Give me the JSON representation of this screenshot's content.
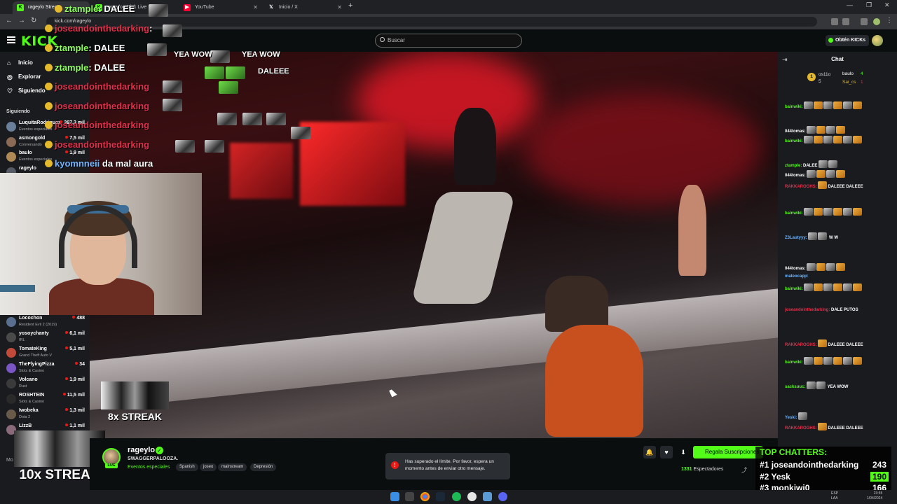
{
  "browser": {
    "tabs": [
      {
        "label": "rageylo Stream",
        "icon": "kick-icon"
      },
      {
        "label": "rageylo - Kick Live",
        "icon": "kick-icon"
      },
      {
        "label": "rageylo",
        "icon": "kick-icon"
      },
      {
        "label": "YouTube",
        "icon": "youtube-icon"
      },
      {
        "label": "Inicio / X",
        "icon": "x-icon"
      }
    ],
    "url": "kick.com/rageylo"
  },
  "header": {
    "logo": "KICK",
    "search_placeholder": "Buscar",
    "kicks_button": "Obtén KICKs"
  },
  "sidebar": {
    "nav": [
      {
        "label": "Inicio",
        "icon": "home-icon"
      },
      {
        "label": "Explorar",
        "icon": "compass-icon"
      },
      {
        "label": "Siguiendo",
        "icon": "heart-icon"
      }
    ],
    "following_title": "Siguiendo",
    "following": [
      {
        "name": "LuquitaRodriguez",
        "category": "Eventos especiales",
        "viewers": "397,3 mil",
        "color": "#6a7f99"
      },
      {
        "name": "asmongold",
        "category": "Conversando",
        "viewers": "7,5 mil",
        "color": "#8a6a55"
      },
      {
        "name": "baulo",
        "category": "Eventos especiales",
        "viewers": "1,9 mil",
        "color": "#b08a55"
      },
      {
        "name": "rageylo",
        "category": "",
        "viewers": "",
        "color": "#555a66"
      }
    ],
    "more": [
      {
        "name": "Locochon",
        "category": "Resident Evil 2 (2019)",
        "viewers": "488",
        "color": "#5a6f8f"
      },
      {
        "name": "yosoychanty",
        "category": "IRL",
        "viewers": "6,1 mil",
        "color": "#4a4a4a"
      },
      {
        "name": "TomateKing",
        "category": "Grand Theft Auto V",
        "viewers": "5,1 mil",
        "color": "#c24a3a"
      },
      {
        "name": "TheFlyingPizza",
        "category": "Slots & Casino",
        "viewers": "34",
        "color": "#7a56c4"
      },
      {
        "name": "Volcano",
        "category": "Rust",
        "viewers": "1,9 mil",
        "color": "#3a3a3a"
      },
      {
        "name": "ROSHTEIN",
        "category": "Slots & Casino",
        "viewers": "11,5 mil",
        "color": "#2a2a2a"
      },
      {
        "name": "Iwobeka",
        "category": "Dota 2",
        "viewers": "1,3 mil",
        "color": "#6a5a4a"
      },
      {
        "name": "LizzB",
        "category": "",
        "viewers": "1,1 mil",
        "color": "#8a6a7a"
      }
    ],
    "more_label": "Mo"
  },
  "overlay_chat": [
    {
      "user": "ztample",
      "msg": "DALEE",
      "color": "green"
    },
    {
      "user": "joseandointhedarking",
      "msg": "",
      "color": "red"
    },
    {
      "user": "ztample",
      "msg": "DALEE",
      "color": "green"
    },
    {
      "user": "ztample",
      "msg": "DALEE",
      "color": "green"
    },
    {
      "user": "joseandointhedarking",
      "msg": "",
      "color": "red"
    },
    {
      "user": "joseandointhedarking",
      "msg": "",
      "color": "red"
    },
    {
      "user": "joseandointhedarking",
      "msg": "",
      "color": "red"
    },
    {
      "user": "joseandointhedarking",
      "msg": "",
      "color": "red"
    },
    {
      "user": "kyomnneii",
      "msg": "da mal aura",
      "color": "blue"
    }
  ],
  "overlay_emote_text": {
    "yeawow_a": "YEA WOW",
    "yeawow_b": "YEA WOW",
    "dalee": "DALEEE"
  },
  "streaks": {
    "small": "8x STREAK",
    "large": "10x STREAK"
  },
  "channel": {
    "name": "rageylo",
    "live_label": "LIVE",
    "title": "SWAGGERPALOOZA.",
    "category": "Eventos especiales",
    "tags": [
      "Spanish",
      "joseo",
      "mainstream",
      "Depresión"
    ],
    "subscribe_label": "Regala Suscripciones",
    "viewers": "1331",
    "viewers_label": "Espectadores"
  },
  "toast": {
    "message": "Has superado el límite. Por favor, espera un momento antes de enviar otro mensaje."
  },
  "chat": {
    "title": "Chat",
    "gifters": [
      {
        "rank": "1",
        "name": "os11o",
        "count": "5"
      },
      {
        "name": "baulo",
        "count": "4"
      },
      {
        "name": "Sai_cs",
        "count": "1"
      }
    ],
    "rows": [
      {
        "user": "bainwiki:",
        "text": "",
        "type": "g"
      },
      {
        "user": "044tomas:",
        "text": "",
        "type": "w"
      },
      {
        "user": "bainwiki:",
        "text": "",
        "type": "g"
      },
      {
        "user": "ztample:",
        "text": "DALEE",
        "type": "g"
      },
      {
        "user": "044tomas:",
        "text": "",
        "type": "w"
      },
      {
        "user": "RAKKAROGHS:",
        "text": "DALEEE DALEEE",
        "type": "r"
      },
      {
        "user": "bainwiki:",
        "text": "",
        "type": "g"
      },
      {
        "user": "Z3Lautyyy:",
        "text": "W W",
        "type": "b"
      },
      {
        "user": "044tomas:",
        "text": "",
        "type": "w"
      },
      {
        "user": "bainwiki:",
        "text": "",
        "type": "g"
      },
      {
        "user": "mateocapp:",
        "text": "",
        "type": "b"
      },
      {
        "user": "joseandointhedarking:",
        "text": "DALE PUTOS",
        "type": "r"
      },
      {
        "user": "RAKKAROGHS:",
        "text": "DALEEE DALEEE",
        "type": "r"
      },
      {
        "user": "bainwiki:",
        "text": "",
        "type": "g"
      },
      {
        "user": "sacksuuc:",
        "text": "YEA WOW",
        "type": "g"
      },
      {
        "user": "Yeski:",
        "text": "",
        "type": "b"
      },
      {
        "user": "RAKKAROGHS:",
        "text": "DALEEE DALEEE",
        "type": "r"
      }
    ]
  },
  "top_chatters": {
    "title": "TOP CHATTERS:",
    "rows": [
      {
        "rank": "#1",
        "name": "joseandointhedarking",
        "count": "243"
      },
      {
        "rank": "#2",
        "name": "Yesk",
        "count": "190"
      },
      {
        "rank": "#3",
        "name": "monkiwi0",
        "count": "166"
      }
    ]
  },
  "taskbar": {
    "lang": "ESP",
    "lang2": "LAA",
    "clock": "23:55",
    "date": "1/04/2024"
  },
  "colors": {
    "kick_green": "#53fc18",
    "live_red": "#e91916",
    "chat_bg": "#191b1f"
  }
}
